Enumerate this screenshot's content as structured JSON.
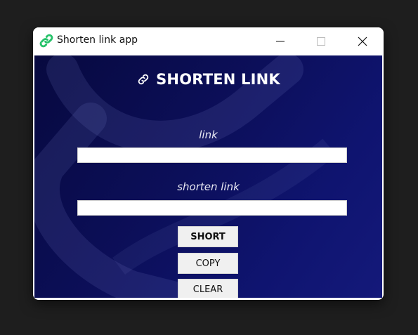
{
  "window": {
    "title": "Shorten link app",
    "app_icon": "chain-link-icon",
    "controls": [
      "minimize-icon",
      "maximize-icon",
      "close-icon"
    ]
  },
  "form": {
    "heading": "SHORTEN LINK",
    "heading_icon": "link-icon",
    "link_label": "link",
    "link_value": "",
    "short_label": "shorten link",
    "short_value": ""
  },
  "buttons": {
    "short": "SHORT",
    "copy": "COPY",
    "clear": "CLEAR"
  },
  "colors": {
    "background_dark": "#07093f",
    "background_light": "#14197a",
    "icon_green": "#2ecc71"
  }
}
